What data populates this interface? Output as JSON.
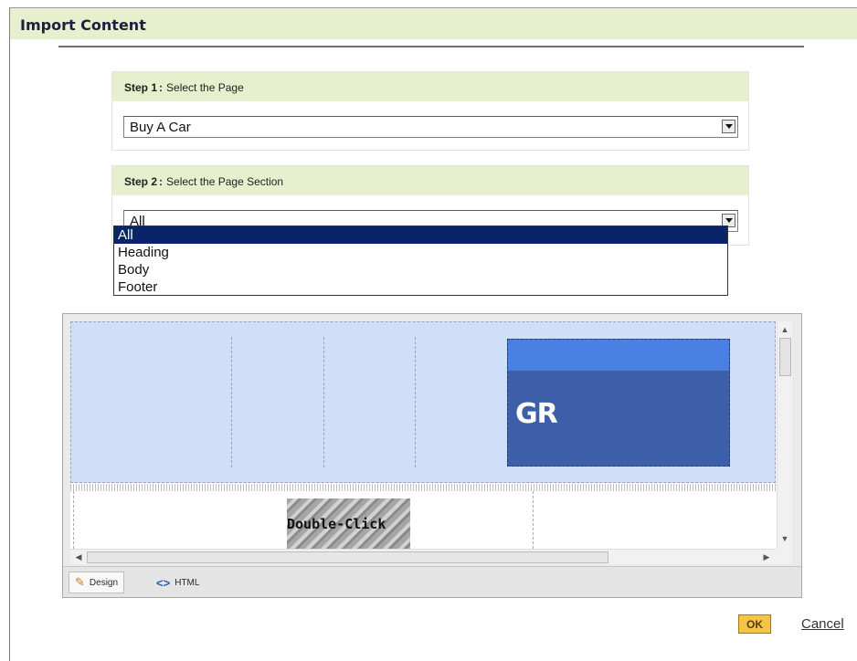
{
  "dialog": {
    "title": "Import Content"
  },
  "step1": {
    "label": "Step 1",
    "separator": ":",
    "text": "Select the Page",
    "selected_value": "Buy A Car"
  },
  "step2": {
    "label": "Step 2",
    "separator": ":",
    "text": "Select the Page Section",
    "selected_value": "All",
    "options": [
      "All",
      "Heading",
      "Body",
      "Footer"
    ]
  },
  "editor": {
    "logo_text": "GR",
    "placeholder_image_text": "Double-Click",
    "tabs": {
      "design": "Design",
      "html": "HTML"
    },
    "icons": {
      "design_tab": "pencil-icon",
      "html_tab": "code-brackets-icon"
    }
  },
  "footer": {
    "ok_label": "OK",
    "cancel_label": "Cancel"
  },
  "colors": {
    "header_bg": "#e6efce",
    "selected_option": "#0a246a",
    "ok_button": "#f5c54a"
  }
}
